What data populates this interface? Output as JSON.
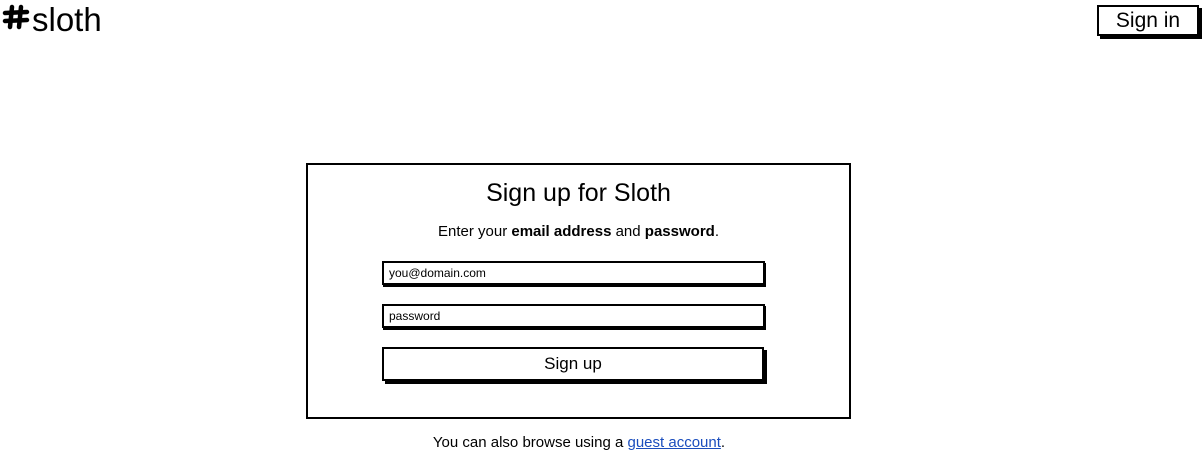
{
  "header": {
    "logo_text": "sloth",
    "logo_icon": "hashtag-icon",
    "signin_label": "Sign in"
  },
  "form": {
    "title": "Sign up for Sloth",
    "subtitle": {
      "pre": "Enter your ",
      "bold1": "email address",
      "mid": " and ",
      "bold2": "password",
      "post": "."
    },
    "email_placeholder": "you@domain.com",
    "password_placeholder": "password",
    "submit_label": "Sign up"
  },
  "footer": {
    "pre": "You can also browse using a ",
    "link": "guest account",
    "post": "."
  }
}
